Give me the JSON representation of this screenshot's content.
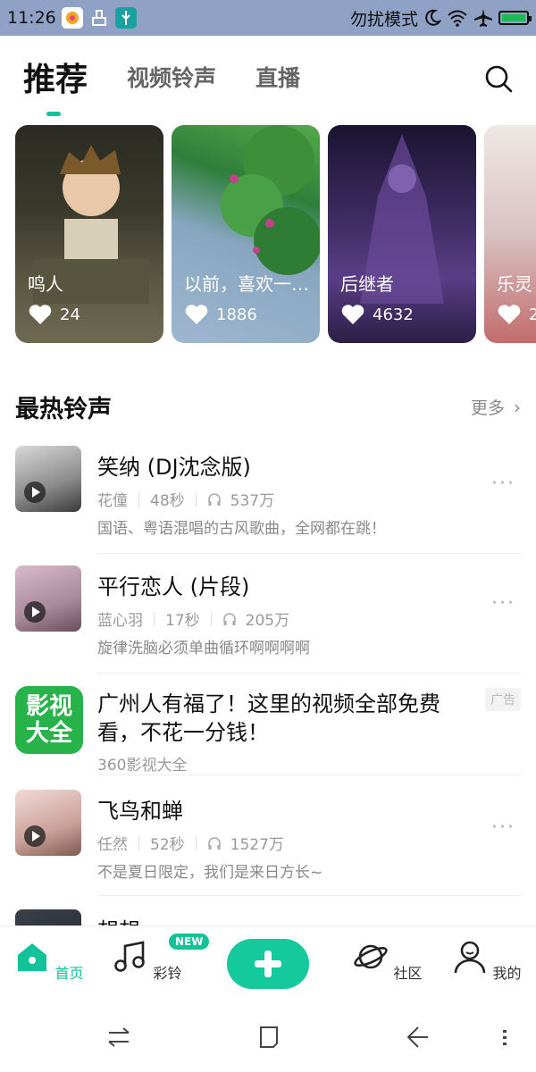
{
  "status_bar": {
    "time": "11:26",
    "right_text": "勿扰模式"
  },
  "header": {
    "tabs": [
      {
        "label": "推荐",
        "active": true
      },
      {
        "label": "视频铃声",
        "active": false
      },
      {
        "label": "直播",
        "active": false
      }
    ]
  },
  "carousel": [
    {
      "title": "鸣人",
      "likes": "24"
    },
    {
      "title": "以前，喜欢一个...",
      "likes": "1886"
    },
    {
      "title": "后继者",
      "likes": "4632"
    },
    {
      "title": "乐灵",
      "likes": "2"
    }
  ],
  "section": {
    "title": "最热铃声",
    "more": "更多"
  },
  "ringtones": [
    {
      "title": "笑纳 (DJ沈念版)",
      "artist": "花僮",
      "duration": "48秒",
      "plays": "537万",
      "desc": "国语、粤语混唱的古风歌曲，全网都在跳！"
    },
    {
      "title": "平行恋人 (片段)",
      "artist": "蓝心羽",
      "duration": "17秒",
      "plays": "205万",
      "desc": "旋律洗脑必须单曲循环啊啊啊啊"
    },
    {
      "title": "飞鸟和蝉",
      "artist": "任然",
      "duration": "52秒",
      "plays": "1527万",
      "desc": "不是夏日限定，我们是来日方长~"
    }
  ],
  "ad": {
    "icon_text": "影视大全",
    "title": "广州人有福了！这里的视频全部免费看，不花一分钱！",
    "source": "360影视大全",
    "badge": "广告"
  },
  "partial_item": {
    "title": "想想"
  },
  "bottom_nav": {
    "items": [
      {
        "label": "首页",
        "active": true
      },
      {
        "label": "彩铃",
        "active": false
      },
      {
        "label": "社区",
        "active": false
      },
      {
        "label": "我的",
        "active": false
      }
    ],
    "new_badge": "NEW"
  },
  "colors": {
    "accent": "#12c39a",
    "status_bar": "#8fa2c6"
  }
}
